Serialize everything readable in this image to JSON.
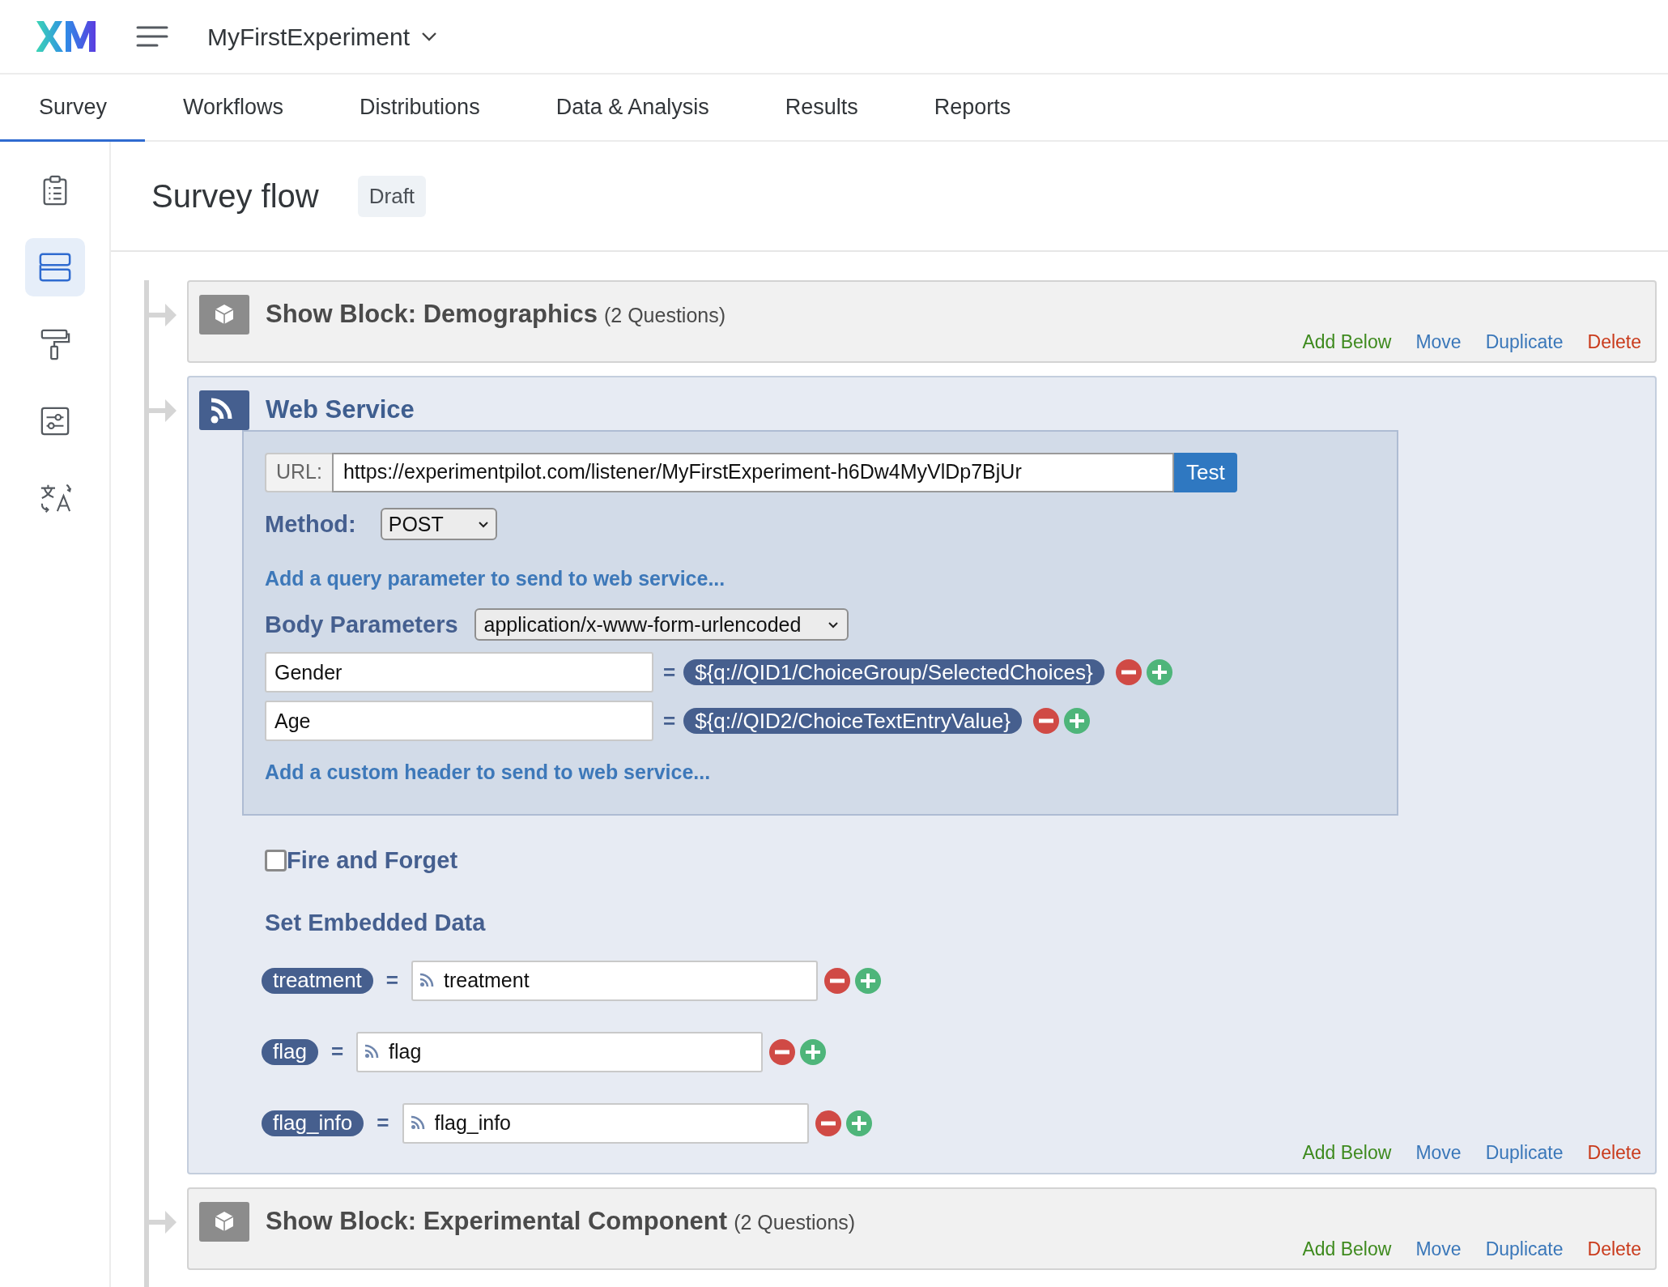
{
  "header": {
    "app_title": "MyFirstExperiment"
  },
  "tabs": [
    {
      "label": "Survey",
      "selected": true
    },
    {
      "label": "Workflows",
      "selected": false
    },
    {
      "label": "Distributions",
      "selected": false
    },
    {
      "label": "Data & Analysis",
      "selected": false
    },
    {
      "label": "Results",
      "selected": false
    },
    {
      "label": "Reports",
      "selected": false
    }
  ],
  "sidebar": {
    "items": [
      {
        "kind": "survey",
        "selected": false
      },
      {
        "kind": "flow",
        "selected": true
      },
      {
        "kind": "look",
        "selected": false
      },
      {
        "kind": "options",
        "selected": false
      },
      {
        "kind": "translate",
        "selected": false
      }
    ]
  },
  "page": {
    "title": "Survey flow",
    "status": "Draft"
  },
  "flow": [
    {
      "kind": "block",
      "title": "Show Block: Demographics",
      "count": "(2 Questions)",
      "actions": [
        {
          "kind": "add",
          "label": "Add Below"
        },
        {
          "kind": "move",
          "label": "Move"
        },
        {
          "kind": "duplicate",
          "label": "Duplicate"
        },
        {
          "kind": "delete",
          "label": "Delete"
        }
      ]
    },
    {
      "kind": "web_service",
      "title": "Web Service",
      "url_label": "URL:",
      "url": "https://experimentpilot.com/listener/MyFirstExperiment-h6Dw4MyVlDp7BjUr",
      "test_button": "Test",
      "method_label": "Method:",
      "method": "POST",
      "query_link": "Add a query parameter to send to web service...",
      "body_label": "Body Parameters",
      "body_encoding": "application/x-www-form-urlencoded",
      "body_params": [
        {
          "key": "Gender",
          "equals": "=",
          "value": "${q://QID1/ChoiceGroup/SelectedChoices}"
        },
        {
          "key": "Age",
          "equals": "=",
          "value": "${q://QID2/ChoiceTextEntryValue}"
        }
      ],
      "header_link": "Add a custom header to send to web service...",
      "fire_and_forget": {
        "label": "Fire and Forget",
        "checked": false
      },
      "embedded_title": "Set Embedded Data",
      "embedded": [
        {
          "name": "treatment",
          "equals": "=",
          "value": "treatment"
        },
        {
          "name": "flag",
          "equals": "=",
          "value": "flag"
        },
        {
          "name": "flag_info",
          "equals": "=",
          "value": "flag_info"
        }
      ],
      "actions": [
        {
          "kind": "add",
          "label": "Add Below"
        },
        {
          "kind": "move",
          "label": "Move"
        },
        {
          "kind": "duplicate",
          "label": "Duplicate"
        },
        {
          "kind": "delete",
          "label": "Delete"
        }
      ]
    },
    {
      "kind": "block",
      "title": "Show Block: Experimental Component",
      "count": "(2 Questions)",
      "actions": [
        {
          "kind": "add",
          "label": "Add Below"
        },
        {
          "kind": "move",
          "label": "Move"
        },
        {
          "kind": "duplicate",
          "label": "Duplicate"
        },
        {
          "kind": "delete",
          "label": "Delete"
        }
      ]
    }
  ]
}
